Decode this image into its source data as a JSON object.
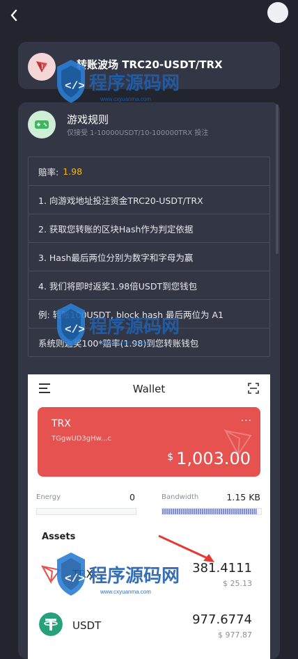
{
  "nav": {
    "back_icon": "chevron-left-icon",
    "avatar_icon": "user-avatar"
  },
  "header_card": {
    "icon": "tron-icon",
    "title": "转账波场 TRC20-USDT/TRX"
  },
  "rules_card": {
    "icon": "gamepad-icon",
    "title": "游戏规则",
    "subtitle": "仅接受 1-10000USDT/10-100000TRX 投注",
    "rate_label": "赔率:",
    "rate_value": "1.98",
    "rules": [
      "1. 向游戏地址投注资金TRC20-USDT/TRX",
      "2. 获取您转账的区块Hash作为判定依据",
      "3. Hash最后两位分别为数字和字母为赢",
      "4. 我们将即时返奖1.98倍USDT到您钱包",
      "例: 转账100USDT, block hash 最后两位为 A1",
      "系统则返奖100*赔率(1.98)到您转账钱包"
    ]
  },
  "wallet": {
    "title": "Wallet",
    "menu_icon": "hamburger-menu-icon",
    "scan_icon": "scan-icon",
    "card": {
      "token": "TRX",
      "address": "TGgwUD3gHw...c",
      "more": "···",
      "currency": "$",
      "balance": "1,003.00",
      "color": "#e5524f"
    },
    "energy": {
      "label": "Energy",
      "value": "0",
      "fill": 0
    },
    "bandwidth": {
      "label": "Bandwidth",
      "value": "1.15 KB",
      "fill": 0.96
    },
    "assets_label": "Assets",
    "assets": [
      {
        "name": "TRX",
        "amount": "381.4111",
        "usd": "$ 25.13",
        "icon": "tron-logo-icon"
      },
      {
        "name": "USDT",
        "amount": "977.6774",
        "usd": "$ 977.87",
        "icon": "tether-logo-icon"
      }
    ]
  },
  "watermark": {
    "text": "程序源码网",
    "url": "www.cxyuanma.com"
  }
}
